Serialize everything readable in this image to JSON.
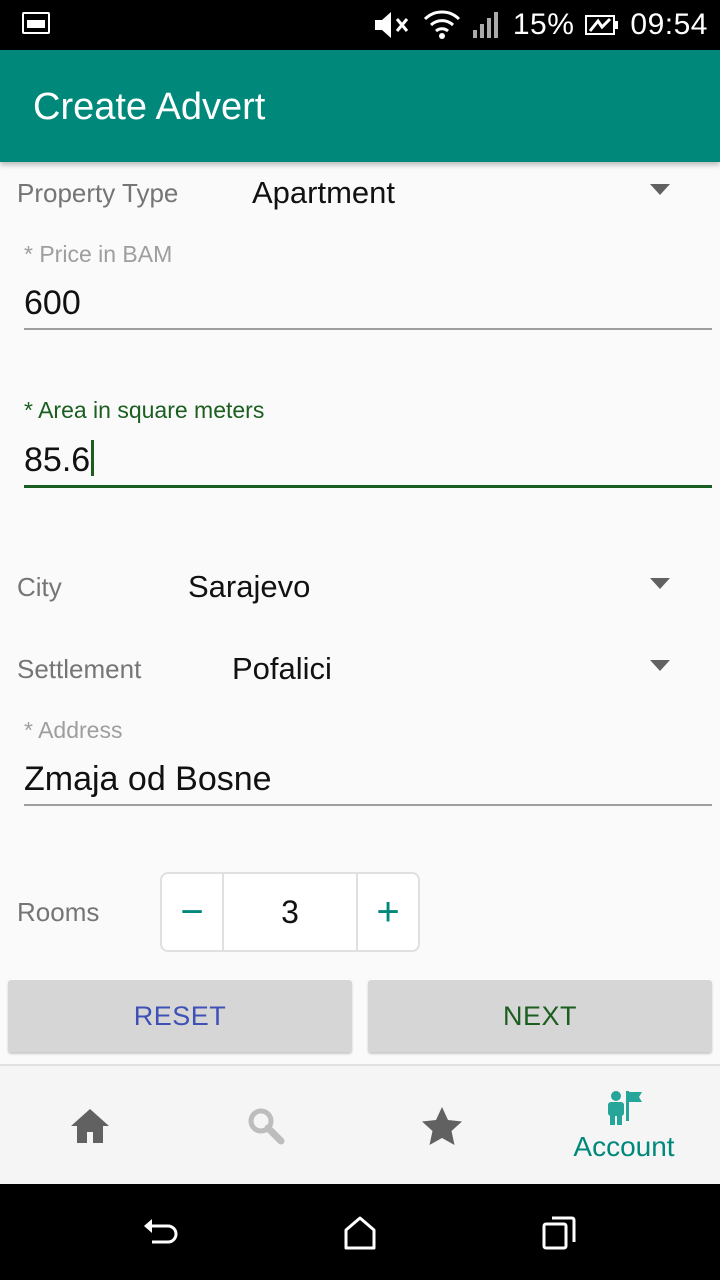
{
  "status_bar": {
    "battery_percent": "15%",
    "time": "09:54",
    "icons": [
      "image-notification-icon",
      "volume-mute-icon",
      "wifi-icon",
      "signal-icon",
      "battery-icon"
    ]
  },
  "app_bar": {
    "title": "Create Advert"
  },
  "form": {
    "property_type": {
      "label": "Property Type",
      "value": "Apartment"
    },
    "price": {
      "label": "* Price in BAM",
      "value": "600"
    },
    "area": {
      "label": "* Area in square meters",
      "value": "85.6"
    },
    "city": {
      "label": "City",
      "value": "Sarajevo"
    },
    "settlement": {
      "label": "Settlement",
      "value": "Pofalici"
    },
    "address": {
      "label": "* Address",
      "value": "Zmaja od Bosne"
    },
    "rooms": {
      "label": "Rooms",
      "value": "3",
      "decrement": "−",
      "increment": "+"
    }
  },
  "actions": {
    "reset_label": "RESET",
    "next_label": "NEXT"
  },
  "bottom_nav": {
    "items": [
      {
        "icon": "home-icon"
      },
      {
        "icon": "search-icon"
      },
      {
        "icon": "star-icon"
      },
      {
        "icon": "account-icon",
        "label": "Account",
        "active": true
      }
    ]
  },
  "colors": {
    "primary": "#00897b",
    "active_field": "#1b5e20",
    "reset_text": "#3f51b5"
  }
}
